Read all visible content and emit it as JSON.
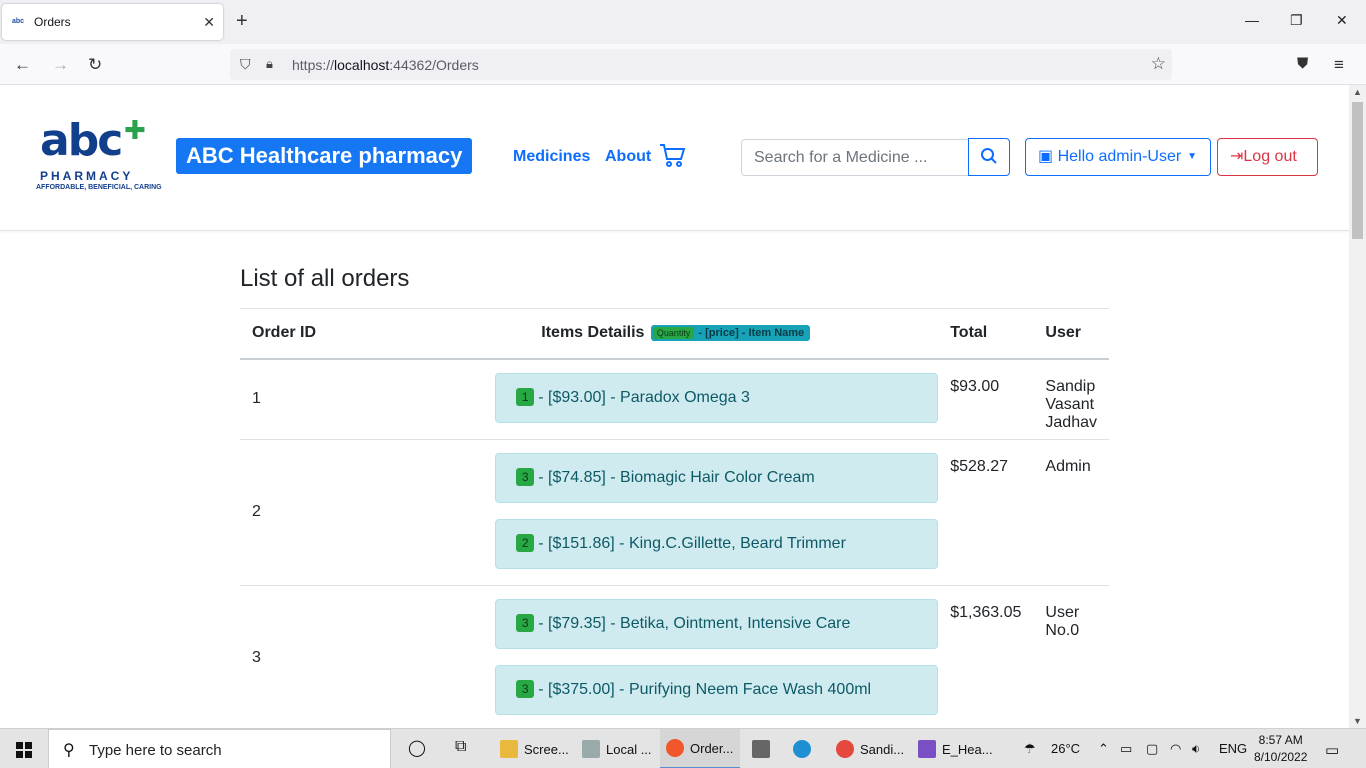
{
  "browser": {
    "tab_title": "Orders",
    "favicon_text": "abc",
    "url_prefix": "https://",
    "url_host": "localhost",
    "url_path": ":44362/Orders"
  },
  "site": {
    "logo_main": "abc",
    "logo_pharmacy": "PHARMACY",
    "logo_tagline": "AFFORDABLE, BENEFICIAL, CARING",
    "brand": "ABC Healthcare pharmacy",
    "nav": [
      "Medicines",
      "About"
    ],
    "search_placeholder": "Search for a Medicine ...",
    "user_button": "Hello admin-User",
    "logout_button": "Log out"
  },
  "orders": {
    "title": "List of all orders",
    "columns": {
      "id": "Order ID",
      "items": "Items Detailis",
      "legend_qty": "Quantity",
      "legend_rest": "- [price] - Item Name",
      "total": "Total",
      "user": "User"
    },
    "rows": [
      {
        "id": "1",
        "total": "$93.00",
        "user": "Sandip Vasant Jadhav",
        "items": [
          {
            "qty": "1",
            "text": "- [$93.00] - Paradox Omega 3"
          }
        ]
      },
      {
        "id": "2",
        "total": "$528.27",
        "user": "Admin",
        "items": [
          {
            "qty": "3",
            "text": "- [$74.85] - Biomagic Hair Color Cream"
          },
          {
            "qty": "2",
            "text": "- [$151.86] - King.C.Gillette, Beard Trimmer"
          }
        ]
      },
      {
        "id": "3",
        "total": "$1,363.05",
        "user": "User No.0",
        "items": [
          {
            "qty": "3",
            "text": "- [$79.35] - Betika, Ointment, Intensive Care"
          },
          {
            "qty": "3",
            "text": "- [$375.00] - Purifying Neem Face Wash 400ml"
          }
        ]
      }
    ]
  },
  "taskbar": {
    "search_placeholder": "Type here to search",
    "apps": [
      "Scree...",
      "Local ...",
      "Order...",
      "Sandi...",
      "E_Hea..."
    ],
    "weather": "26°C",
    "lang": "ENG",
    "time": "8:57 AM",
    "date": "8/10/2022"
  }
}
